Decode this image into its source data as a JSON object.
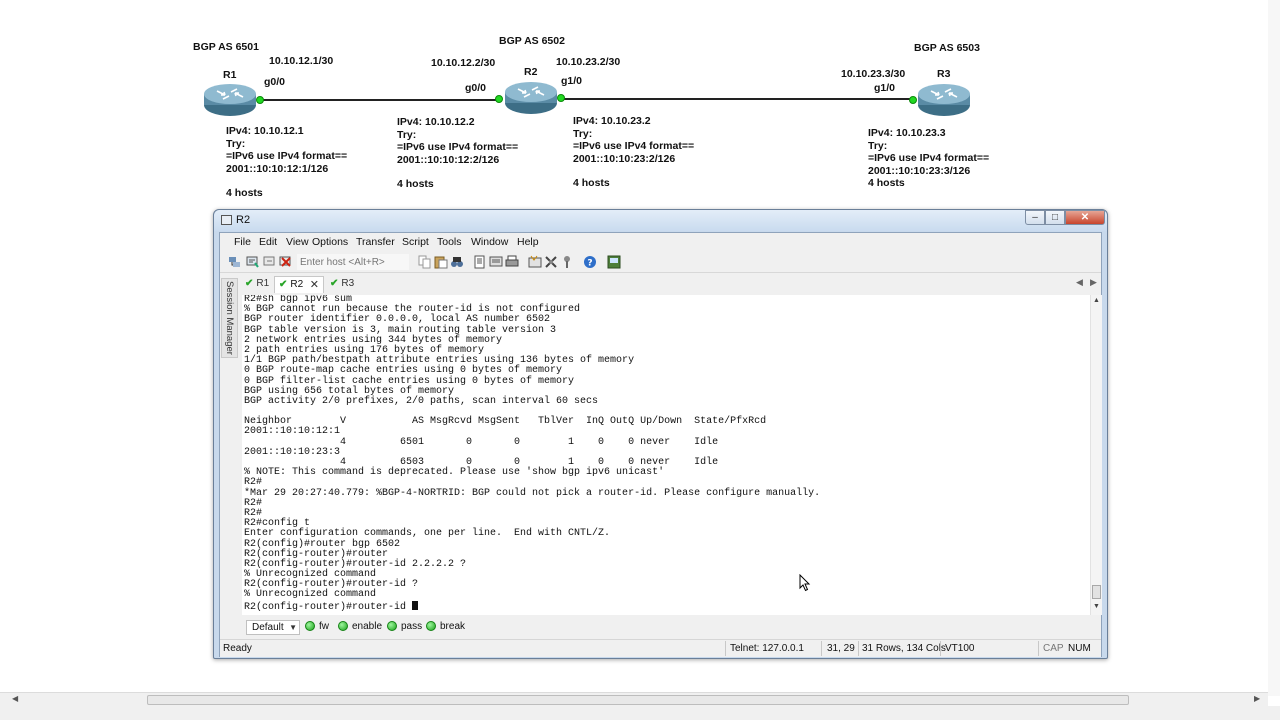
{
  "topology": {
    "r1": {
      "as_label": "BGP AS 6501",
      "name": "R1",
      "link_addr": "10.10.12.1/30",
      "port": "g0/0",
      "info": [
        "IPv4: 10.10.12.1",
        "Try:",
        "=IPv6 use IPv4 format==",
        "2001::10:10:12:1/126",
        "",
        "4 hosts"
      ]
    },
    "r2": {
      "as_label": "BGP AS 6502",
      "name": "R2",
      "left_addr": "10.10.12.2/30",
      "left_port": "g0/0",
      "right_addr": "10.10.23.2/30",
      "right_port": "g1/0",
      "info_left": [
        "IPv4: 10.10.12.2",
        "Try:",
        "=IPv6 use IPv4 format==",
        "2001::10:10:12:2/126",
        "",
        "4 hosts"
      ],
      "info_right": [
        "IPv4: 10.10.23.2",
        "Try:",
        "=IPv6 use IPv4 format==",
        "2001::10:10:23:2/126",
        "",
        "4 hosts"
      ]
    },
    "r3": {
      "as_label": "BGP AS 6503",
      "name": "R3",
      "link_addr": "10.10.23.3/30",
      "port": "g1/0",
      "info": [
        "IPv4: 10.10.23.3",
        "Try:",
        "=IPv6 use IPv4 format==",
        "2001::10:10:23:3/126",
        "4 hosts"
      ]
    }
  },
  "window": {
    "title": "R2",
    "controls": {
      "minimize": "–",
      "maximize": "□",
      "close": "✕"
    },
    "menus": [
      "File",
      "Edit",
      "View",
      "Options",
      "Transfer",
      "Script",
      "Tools",
      "Window",
      "Help"
    ],
    "host_placeholder": "Enter host <Alt+R>",
    "session_manager_label": "Session Manager",
    "tabs": [
      {
        "label": "R1",
        "active": false
      },
      {
        "label": "R2",
        "active": true
      },
      {
        "label": "R3",
        "active": false
      }
    ],
    "tab_close": "✕",
    "tab_prev": "◀",
    "tab_next": "▶",
    "terminal_lines": [
      "R2#sh bgp ipv6 sum",
      "% BGP cannot run because the router-id is not configured",
      "BGP router identifier 0.0.0.0, local AS number 6502",
      "BGP table version is 3, main routing table version 3",
      "2 network entries using 344 bytes of memory",
      "2 path entries using 176 bytes of memory",
      "1/1 BGP path/bestpath attribute entries using 136 bytes of memory",
      "0 BGP route-map cache entries using 0 bytes of memory",
      "0 BGP filter-list cache entries using 0 bytes of memory",
      "BGP using 656 total bytes of memory",
      "BGP activity 2/0 prefixes, 2/0 paths, scan interval 60 secs",
      "",
      "Neighbor        V           AS MsgRcvd MsgSent   TblVer  InQ OutQ Up/Down  State/PfxRcd",
      "2001::10:10:12:1",
      "                4         6501       0       0        1    0    0 never    Idle",
      "2001::10:10:23:3",
      "                4         6503       0       0        1    0    0 never    Idle",
      "% NOTE: This command is deprecated. Please use 'show bgp ipv6 unicast'",
      "R2#",
      "*Mar 29 20:27:40.779: %BGP-4-NORTRID: BGP could not pick a router-id. Please configure manually.",
      "R2#",
      "R2#",
      "R2#config t",
      "Enter configuration commands, one per line.  End with CNTL/Z.",
      "R2(config)#router bgp 6502",
      "R2(config-router)#router",
      "R2(config-router)#router-id 2.2.2.2 ?",
      "% Unrecognized command",
      "R2(config-router)#router-id ?",
      "% Unrecognized command",
      "R2(config-router)#router-id "
    ],
    "button_bar": {
      "session": "Default",
      "buttons": [
        "fw",
        "enable",
        "pass",
        "break"
      ]
    },
    "status": {
      "ready": "Ready",
      "connection": "Telnet: 127.0.0.1",
      "position": "31, 29",
      "size": "31 Rows, 134 Cols",
      "emulation": "VT100",
      "caps": "CAP",
      "num": "NUM"
    }
  },
  "colors": {
    "link_dot": "#22d822",
    "title_grad": "#c9dbef",
    "close_red": "#c8452d"
  },
  "icons": [
    "router-icon",
    "terminal-icon",
    "connect-icon",
    "quick-connect-icon",
    "disconnect-icon",
    "copy-icon",
    "paste-icon",
    "find-icon",
    "print-icon",
    "options-icon",
    "map-icon",
    "key-icon",
    "help-icon",
    "sftp-icon"
  ]
}
